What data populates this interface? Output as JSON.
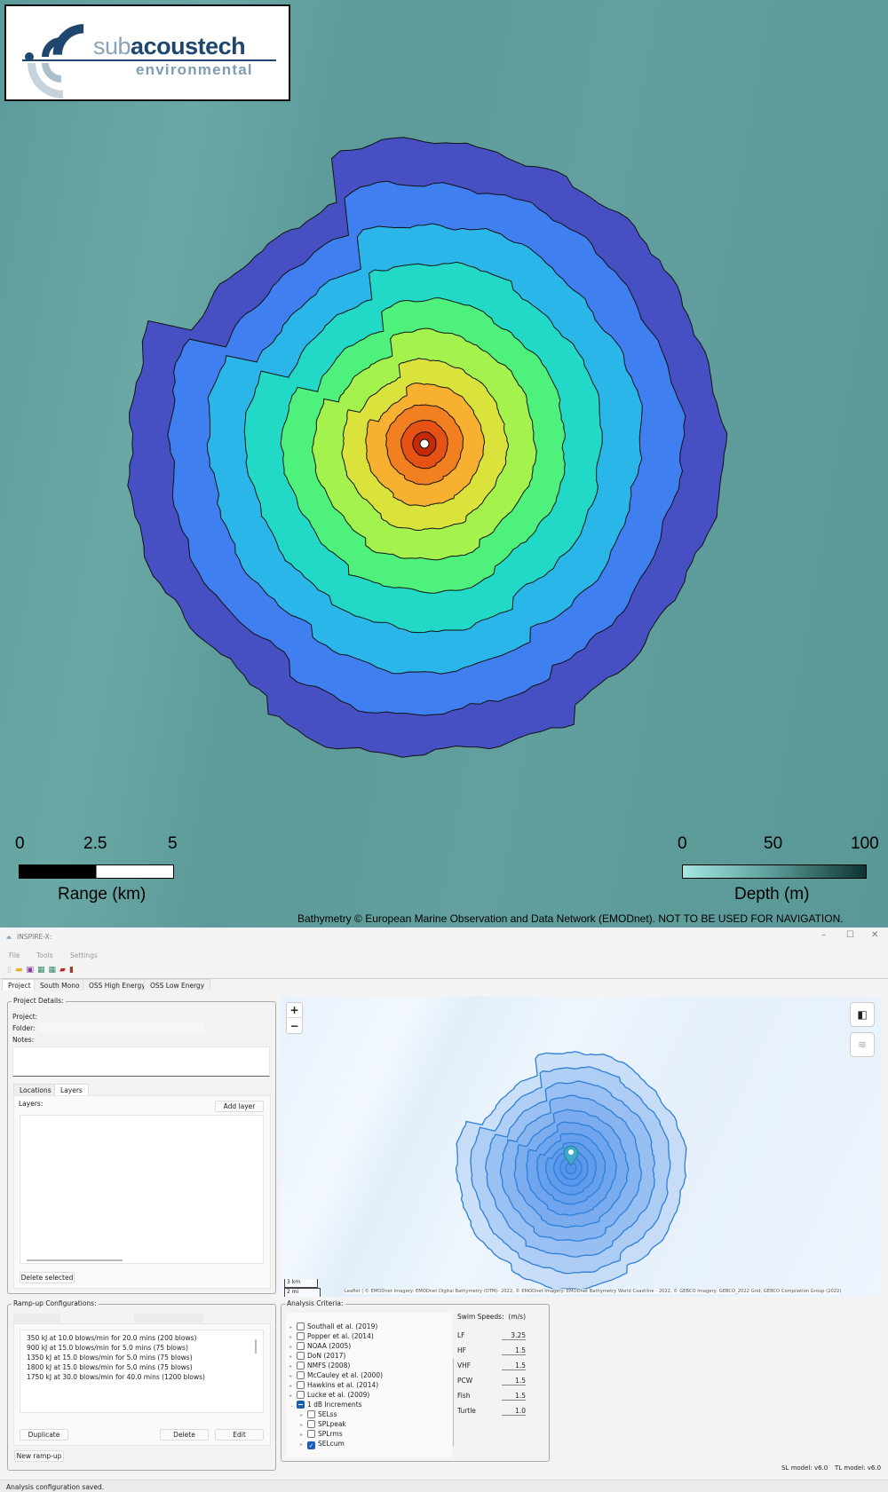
{
  "logo": {
    "text_sub": "sub",
    "text_acoustech": "acoustech",
    "text_env": "environmental"
  },
  "range_scale": {
    "ticks": [
      "0",
      "2.5",
      "5"
    ],
    "label": "Range (km)"
  },
  "depth_scale": {
    "ticks": [
      "0",
      "50",
      "100"
    ],
    "label": "Depth (m)",
    "colors": [
      "#a6e6e2",
      "#0c3432"
    ]
  },
  "attribution_top": "Bathymetry © European Marine Observation and Data Network (EMODnet). NOT TO BE USED FOR NAVIGATION.",
  "contour_colors": [
    "#4650c2",
    "#3f7ff0",
    "#2bb6ea",
    "#22d8c6",
    "#4ef17c",
    "#a3f24e",
    "#d9e33c",
    "#f8b030",
    "#f28020",
    "#e65213",
    "#c42a08"
  ],
  "app": {
    "title": "INSPIRE-X:",
    "menu": [
      "File",
      "Tools",
      "Settings"
    ],
    "tabs": [
      "Project",
      "South Mono",
      "OSS High Energy",
      "OSS Low Energy"
    ],
    "project_details": {
      "legend": "Project Details:",
      "project_label": "Project:",
      "folder_label": "Folder:",
      "notes_label": "Notes:"
    },
    "subtabs": [
      "Locations",
      "Layers"
    ],
    "layers": {
      "label": "Layers:",
      "add_button": "Add layer",
      "delete_button": "Delete selected"
    },
    "rampup": {
      "legend": "Ramp-up Configurations:",
      "items": [
        "350 kJ at 10.0 blows/min for 20.0 mins (200 blows)",
        "900 kJ at 15.0 blows/min for 5.0 mins (75 blows)",
        "1350 kJ at 15.0 blows/min for 5.0 mins (75 blows)",
        "1800 kJ at 15.0 blows/min for 5.0 mins (75 blows)",
        "1750 kJ at 30.0 blows/min for 40.0 mins (1200 blows)"
      ],
      "duplicate": "Duplicate",
      "delete": "Delete",
      "edit": "Edit",
      "new": "New ramp-up"
    },
    "analysis": {
      "legend": "Analysis Criteria:",
      "criteria": [
        "Southall et al. (2019)",
        "Popper et al. (2014)",
        "NOAA (2005)",
        "DoN (2017)",
        "NMFS (2008)",
        "McCauley et al. (2000)",
        "Hawkins et al. (2014)",
        "Lucke et al. (2009)",
        "1 dB Increments"
      ],
      "sub": [
        {
          "label": "SELss",
          "checked": false
        },
        {
          "label": "SPLpeak",
          "checked": false
        },
        {
          "label": "SPLrms",
          "checked": false
        },
        {
          "label": "SELcum",
          "checked": true
        }
      ],
      "swim_title": "Swim Speeds:",
      "swim_unit": "(m/s)",
      "swim": [
        {
          "label": "LF",
          "value": "3.25"
        },
        {
          "label": "HF",
          "value": "1.5"
        },
        {
          "label": "VHF",
          "value": "1.5"
        },
        {
          "label": "PCW",
          "value": "1.5"
        },
        {
          "label": "Fish",
          "value": "1.5"
        },
        {
          "label": "Turtle",
          "value": "1.0"
        }
      ]
    },
    "map": {
      "zoom_in": "+",
      "zoom_out": "−",
      "scale_km": "3 km",
      "scale_mi": "2 mi",
      "attribution": "Leaflet | © EMODnet Imagery: EMODnet Digital Bathymetry (DTM)- 2022, © EMODnet Imagery: EMODnet Bathymetry World Coastline - 2022, © GEBCO Imagery: GEBCO_2022 Grid, GEBCO Compilation Group (2022)"
    },
    "status": "Analysis configuration saved.",
    "sl_model": "SL model: v6.0",
    "tl_model": "TL model: v6.0"
  }
}
